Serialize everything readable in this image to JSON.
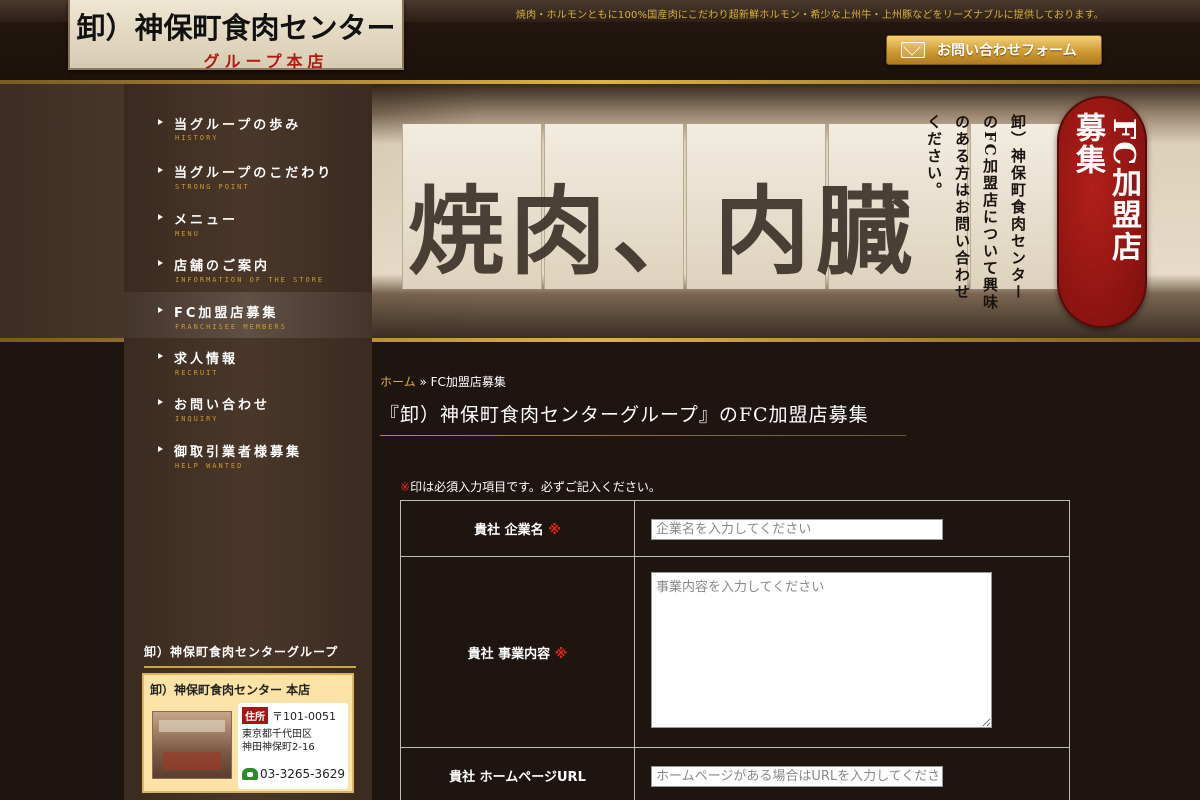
{
  "header": {
    "tagline": "焼肉・ホルモンともに100%国産肉にこだわり超新鮮ホルモン・希少な上州牛・上州豚などをリーズナブルに提供しております。",
    "logo_line1": "卸）神保町食肉センター",
    "logo_line2": "グループ本店",
    "contact_button": "お問い合わせフォーム"
  },
  "banner": {
    "big_text": "焼肉、内臓",
    "vertical_text": "卸）神保町食肉センターのFC加盟店について興味のある方はお問い合わせください。",
    "badge_line1": "FC加盟店",
    "badge_line2": "募集"
  },
  "sidebar": {
    "items": [
      {
        "label": "当グループの歩み",
        "sub": "HISTORY"
      },
      {
        "label": "当グループのこだわり",
        "sub": "STRONG POINT"
      },
      {
        "label": "メニュー",
        "sub": "MENU"
      },
      {
        "label": "店舗のご案内",
        "sub": "INFORMATION OF THE STORE"
      },
      {
        "label": "FC加盟店募集",
        "sub": "FRANCHISEE MEMBERS"
      },
      {
        "label": "求人情報",
        "sub": "RECRUIT"
      },
      {
        "label": "お問い合わせ",
        "sub": "INQUIRY"
      },
      {
        "label": "御取引業者様募集",
        "sub": "HELP WANTED"
      }
    ],
    "group_title": "卸）神保町食肉センターグループ",
    "store": {
      "name": "卸）神保町食肉センター 本店",
      "address_badge": "住所",
      "zip": "〒101-0051",
      "address1": "東京都千代田区",
      "address2": "神田神保町2-16",
      "tel": "03-3265-3629"
    }
  },
  "main": {
    "breadcrumb_home": "ホーム",
    "breadcrumb_sep": "»",
    "breadcrumb_current": "FC加盟店募集",
    "title": "『卸）神保町食肉センターグループ』のFC加盟店募集",
    "note_mark": "※",
    "note_text": "印は必須入力項目です。必ずご記入ください。",
    "form": {
      "company_label": "貴社 企業名",
      "company_placeholder": "企業名を入力してください",
      "business_label": "貴社 事業内容",
      "business_placeholder": "事業内容を入力してください",
      "homepage_label": "貴社 ホームページURL",
      "homepage_placeholder": "ホームページがある場合はURLを入力してください",
      "required_mark": "※"
    }
  },
  "colors": {
    "accent_gold": "#d8b13a",
    "required_red": "#e0261a",
    "badge_red": "#a51611"
  }
}
